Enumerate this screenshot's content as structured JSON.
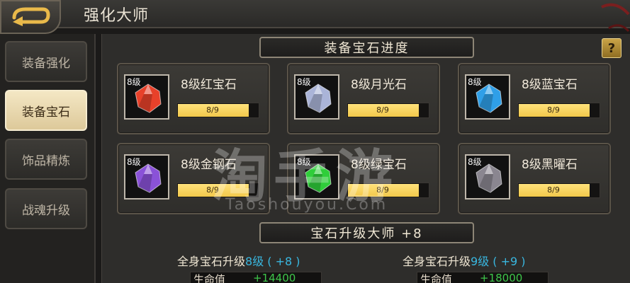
{
  "header": {
    "title": "强化大师"
  },
  "sidebar": {
    "items": [
      {
        "label": "装备强化",
        "active": false
      },
      {
        "label": "装备宝石",
        "active": true
      },
      {
        "label": "饰品精炼",
        "active": false
      },
      {
        "label": "战魂升级",
        "active": false
      }
    ]
  },
  "progress_section": {
    "title": "装备宝石进度",
    "help_label": "?"
  },
  "gems": [
    {
      "level_tag": "8级",
      "name": "8级红宝石",
      "progress_text": "8/9",
      "progress": 0.889,
      "color": "#e8412a",
      "icon": "red-gem-icon"
    },
    {
      "level_tag": "8级",
      "name": "8级月光石",
      "progress_text": "8/9",
      "progress": 0.889,
      "color": "#aab4d8",
      "icon": "moonstone-icon"
    },
    {
      "level_tag": "8级",
      "name": "8级蓝宝石",
      "progress_text": "8/9",
      "progress": 0.889,
      "color": "#2f9fe8",
      "icon": "blue-gem-icon"
    },
    {
      "level_tag": "8级",
      "name": "8级金钢石",
      "progress_text": "8/9",
      "progress": 0.889,
      "color": "#8a52d8",
      "icon": "diamond-gem-icon"
    },
    {
      "level_tag": "8级",
      "name": "8级绿宝石",
      "progress_text": "8/9",
      "progress": 0.889,
      "color": "#2fce3a",
      "icon": "green-gem-icon"
    },
    {
      "level_tag": "8级",
      "name": "8级黑曜石",
      "progress_text": "8/9",
      "progress": 0.889,
      "color": "#8a8690",
      "icon": "obsidian-icon"
    }
  ],
  "master_section": {
    "title": "宝石升级大师 +8",
    "current": {
      "prefix": "全身宝石升级",
      "level": "8级 ( +8 )",
      "stat_label": "生命值",
      "stat_value": "+14400"
    },
    "next": {
      "prefix": "全身宝石升级",
      "level": "9级 ( +9 )",
      "stat_label": "生命值",
      "stat_value": "+18000"
    }
  },
  "watermark": {
    "main": "淘手游",
    "sub": "Taoshouyou.Com"
  }
}
